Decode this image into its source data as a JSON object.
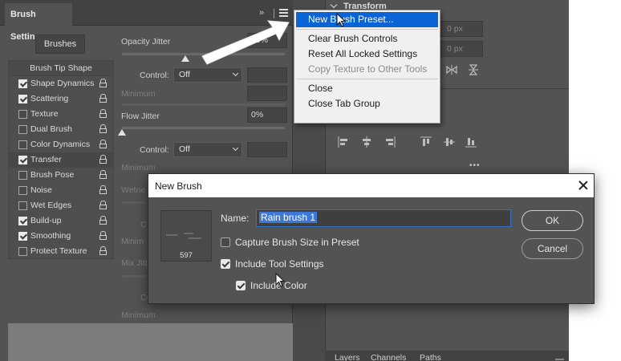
{
  "brush_panel": {
    "tab_label": "Brush Settings",
    "collapse_icon": "»",
    "brushes_button": "Brushes",
    "list": [
      {
        "label": "Brush Tip Shape",
        "header": true
      },
      {
        "label": "Shape Dynamics",
        "checked": true
      },
      {
        "label": "Scattering",
        "checked": true
      },
      {
        "label": "Texture",
        "checked": false
      },
      {
        "label": "Dual Brush",
        "checked": false
      },
      {
        "label": "Color Dynamics",
        "checked": false
      },
      {
        "label": "Transfer",
        "checked": true,
        "selected": true
      },
      {
        "label": "Brush Pose",
        "checked": false
      },
      {
        "label": "Noise",
        "checked": false
      },
      {
        "label": "Wet Edges",
        "checked": false
      },
      {
        "label": "Build-up",
        "checked": true
      },
      {
        "label": "Smoothing",
        "checked": true
      },
      {
        "label": "Protect Texture",
        "checked": false
      }
    ],
    "opacity_jitter_label": "Opacity Jitter",
    "opacity_jitter_value": "39%",
    "opacity_jitter_fraction": 0.39,
    "control_label": "Control:",
    "control_value": "Off",
    "minimum_label": "Minimum",
    "flow_jitter_label": "Flow Jitter",
    "flow_jitter_value": "0%",
    "flow_jitter_fraction": 0,
    "control2_label": "Control:",
    "control2_value": "Off",
    "minimum2_label": "Minimum",
    "wetness_partial": "Wetne",
    "co_partial": "C",
    "minimum3_partial": "Minim",
    "mix_partial": "Mix Jitt",
    "co2_partial": "Co",
    "minimum4_label": "Minimum"
  },
  "transform_panel": {
    "title": "Transform",
    "field1": "0 px",
    "field2": "0 px",
    "more_icon": "•••"
  },
  "bottom_tabs": [
    "Layers",
    "Channels",
    "Paths"
  ],
  "menu": {
    "items": [
      {
        "label": "New Brush Preset...",
        "highlighted": true
      },
      {
        "sep": true
      },
      {
        "label": "Clear Brush Controls"
      },
      {
        "label": "Reset All Locked Settings"
      },
      {
        "label": "Copy Texture to Other Tools",
        "disabled": true
      },
      {
        "sep": true
      },
      {
        "label": "Close"
      },
      {
        "label": "Close Tab Group"
      }
    ]
  },
  "dialog": {
    "title": "New Brush",
    "name_label": "Name:",
    "name_value": "Rain brush 1",
    "brush_size": "597",
    "capture_label": "Capture Brush Size in Preset",
    "capture_checked": false,
    "tool_settings_label": "Include Tool Settings",
    "tool_settings_checked": true,
    "include_color_label": "Include Color",
    "include_color_checked": true,
    "ok_label": "OK",
    "cancel_label": "Cancel"
  },
  "colors": {
    "menu_highlight": "#0a64d6",
    "selection": "#3d78d8",
    "panel_bg": "#535353"
  }
}
